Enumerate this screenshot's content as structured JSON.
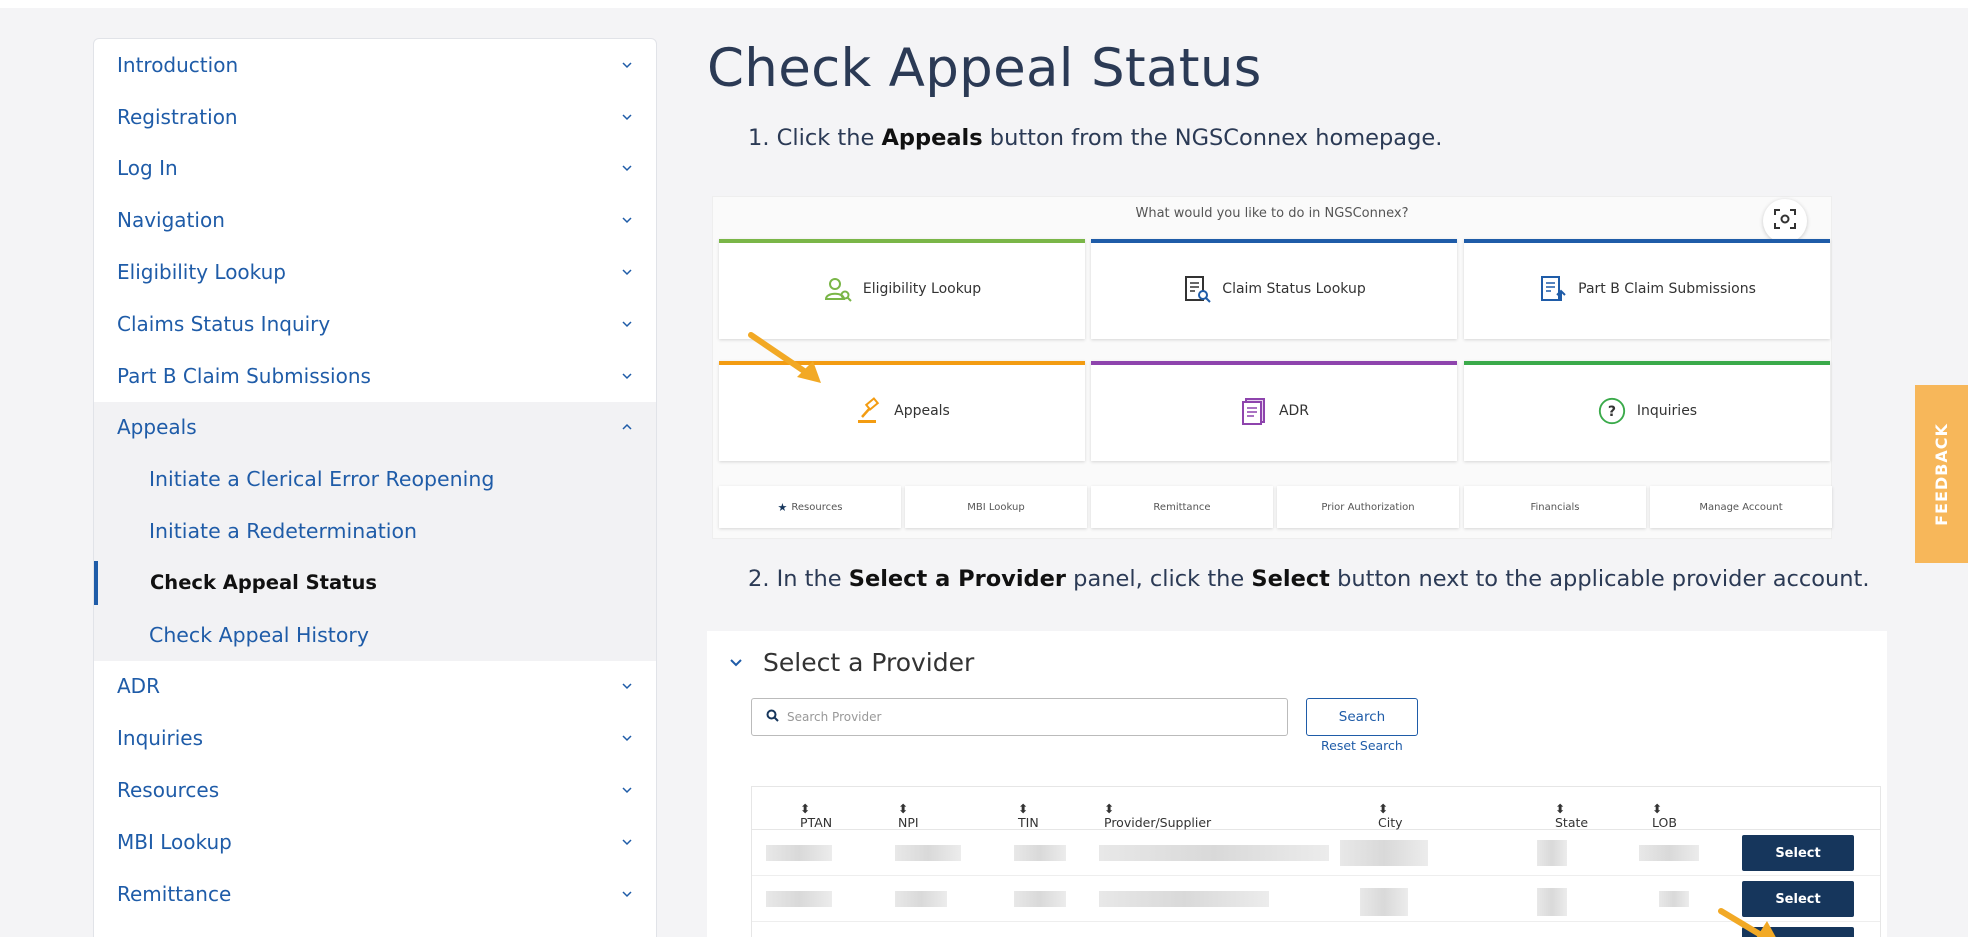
{
  "sidebar": {
    "items_top": [
      {
        "label": "Introduction"
      },
      {
        "label": "Registration"
      },
      {
        "label": "Log In"
      },
      {
        "label": "Navigation"
      },
      {
        "label": "Eligibility Lookup"
      },
      {
        "label": "Claims Status Inquiry"
      },
      {
        "label": "Part B Claim Submissions"
      }
    ],
    "appeals": {
      "label": "Appeals",
      "expanded": true,
      "children": [
        {
          "label": "Initiate a Clerical Error Reopening"
        },
        {
          "label": "Initiate a Redetermination"
        },
        {
          "label": "Check Appeal Status",
          "active": true
        },
        {
          "label": "Check Appeal History"
        }
      ]
    },
    "items_bottom": [
      {
        "label": "ADR"
      },
      {
        "label": "Inquiries"
      },
      {
        "label": "Resources"
      },
      {
        "label": "MBI Lookup"
      },
      {
        "label": "Remittance"
      }
    ]
  },
  "main": {
    "title": "Check Appeal Status",
    "step1": {
      "prefix": "1. Click the ",
      "bold": "Appeals",
      "suffix": " button from the NGSConnex homepage."
    },
    "step2": {
      "prefix": "2. In the ",
      "bold1": "Select a Provider",
      "middle": " panel, click the ",
      "bold2": "Select",
      "suffix": " button next to the applicable provider account."
    }
  },
  "screenshot1": {
    "question": "What would you like to do in NGSConnex?",
    "tiles": [
      {
        "label": "Eligibility Lookup",
        "icon": "person-search-icon",
        "color": "#7ab648"
      },
      {
        "label": "Claim Status Lookup",
        "icon": "document-search-icon",
        "color": "#1f5ca8"
      },
      {
        "label": "Part B Claim Submissions",
        "icon": "document-upload-icon",
        "color": "#1f5ca8"
      },
      {
        "label": "Appeals",
        "icon": "gavel-icon",
        "color": "#f39c12"
      },
      {
        "label": "ADR",
        "icon": "document-stack-icon",
        "color": "#8e44ad"
      },
      {
        "label": "Inquiries",
        "icon": "question-circle-icon",
        "color": "#3aaa4a"
      }
    ],
    "small_tiles": [
      "Resources",
      "MBI Lookup",
      "Remittance",
      "Prior Authorization",
      "Financials",
      "Manage Account"
    ]
  },
  "screenshot2": {
    "panel_title": "Select a Provider",
    "search_placeholder": "Search Provider",
    "search_button": "Search",
    "reset_link": "Reset Search",
    "columns": [
      "PTAN",
      "NPI",
      "TIN",
      "Provider/Supplier",
      "City",
      "State",
      "LOB"
    ],
    "select_label": "Select"
  },
  "feedback": "FEEDBACK",
  "colors": {
    "link": "#1f5ca8",
    "title": "#2b3a55",
    "feedback": "#f7b75a",
    "select_button": "#16365c",
    "arrow": "#f2a925"
  }
}
